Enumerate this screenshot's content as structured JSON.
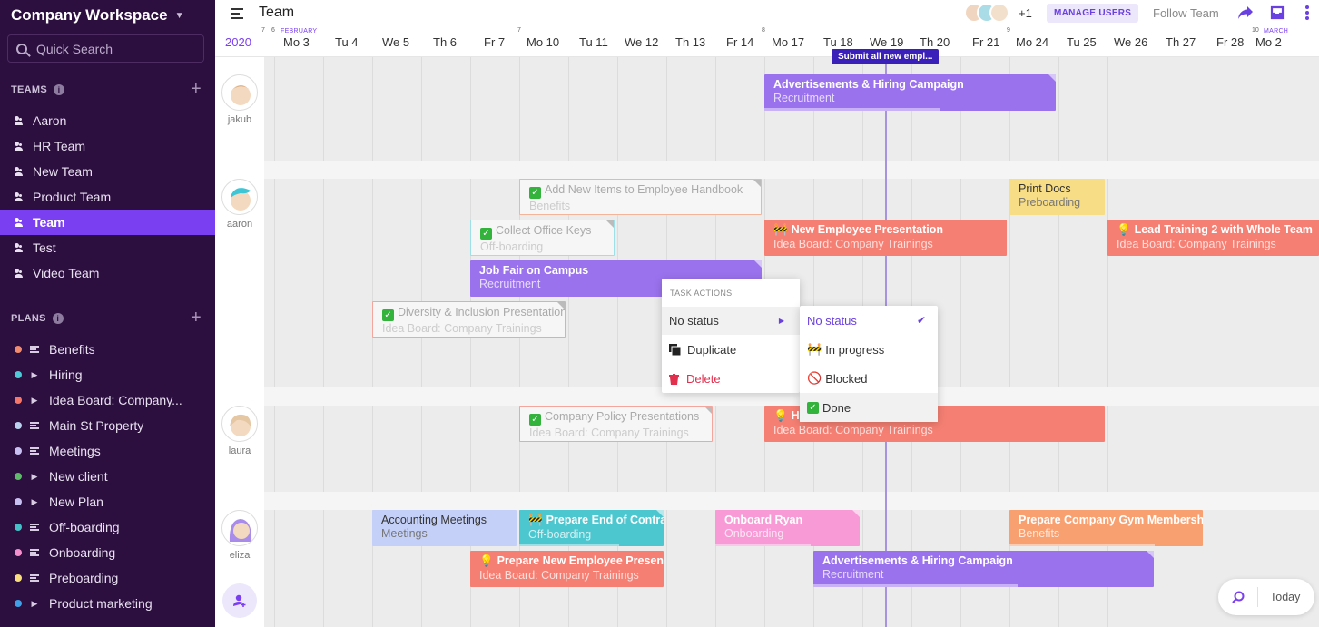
{
  "sidebar": {
    "workspace": "Company Workspace",
    "search_placeholder": "Quick Search",
    "teams_heading": "TEAMS",
    "teams": [
      "Aaron",
      "HR Team",
      "New Team",
      "Product Team",
      "Team",
      "Test",
      "Video Team"
    ],
    "plans_heading": "PLANS",
    "plans": [
      {
        "label": "Benefits",
        "color": "#f28b6e",
        "expandable": false
      },
      {
        "label": "Hiring",
        "color": "#4fc9d8",
        "expandable": true
      },
      {
        "label": "Idea Board: Company...",
        "color": "#f4776a",
        "expandable": true
      },
      {
        "label": "Main St Property",
        "color": "#b9d2f0",
        "expandable": false
      },
      {
        "label": "Meetings",
        "color": "#c8c0f2",
        "expandable": false
      },
      {
        "label": "New client",
        "color": "#5eb96a",
        "expandable": true
      },
      {
        "label": "New Plan",
        "color": "#c8c0f2",
        "expandable": true
      },
      {
        "label": "Off-boarding",
        "color": "#45c0c8",
        "expandable": false
      },
      {
        "label": "Onboarding",
        "color": "#f48fce",
        "expandable": false
      },
      {
        "label": "Preboarding",
        "color": "#f7dd7e",
        "expandable": false
      },
      {
        "label": "Product marketing",
        "color": "#3ea0e8",
        "expandable": true
      }
    ]
  },
  "topbar": {
    "title": "Team",
    "extra_users": "+1",
    "manage_users": "MANAGE USERS",
    "follow": "Follow Team"
  },
  "timeline": {
    "year": "2020",
    "month_feb": "FEBRUARY",
    "month_mar": "MARCH",
    "small_nums": [
      "7",
      "6",
      "7",
      "8",
      "9",
      "10"
    ],
    "days": [
      "Mo 3",
      "Tu 4",
      "We 5",
      "Th 6",
      "Fr 7",
      "Mo 10",
      "Tu 11",
      "We 12",
      "Th 13",
      "Fr 14",
      "Mo 17",
      "Tu 18",
      "We 19",
      "Th 20",
      "Fr 21",
      "Mo 24",
      "Tu 25",
      "We 26",
      "Th 27",
      "Fr 28",
      "Mo 2"
    ]
  },
  "milestone": "Submit all new empl...",
  "people": [
    "jakub",
    "aaron",
    "laura",
    "eliza"
  ],
  "tasks": [
    {
      "title": "Advertisements & Hiring Campaign",
      "plan": "Recruitment"
    },
    {
      "title": "Add New Items to Employee Handbook",
      "plan": "Benefits"
    },
    {
      "title": "Print Docs",
      "plan": "Preboarding"
    },
    {
      "title": "Collect Office Keys",
      "plan": "Off-boarding"
    },
    {
      "title": "New Employee Presentation",
      "plan": "Idea Board: Company Trainings"
    },
    {
      "title": "Lead Training 2 with Whole Team",
      "plan": "Idea Board: Company Trainings"
    },
    {
      "title": "Job Fair on Campus",
      "plan": "Recruitment"
    },
    {
      "title": "Diversity & Inclusion Presentation",
      "plan": "Idea Board: Company Trainings"
    },
    {
      "title": "Company Policy Presentations",
      "plan": "Idea Board: Company Trainings"
    },
    {
      "title": "Ho",
      "plan": "Idea Board: Company Trainings"
    },
    {
      "title": "Accounting Meetings",
      "plan": "Meetings"
    },
    {
      "title": "Prepare End of Contra",
      "plan": "Off-boarding"
    },
    {
      "title": "Onboard Ryan",
      "plan": "Onboarding"
    },
    {
      "title": "Prepare Company Gym Membershi",
      "plan": "Benefits"
    },
    {
      "title": "Prepare New Employee Presenta",
      "plan": "Idea Board: Company Trainings"
    },
    {
      "title": "Advertisements & Hiring Campaign",
      "plan": "Recruitment"
    }
  ],
  "menu": {
    "heading": "TASK ACTIONS",
    "status": "No status",
    "duplicate": "Duplicate",
    "delete": "Delete"
  },
  "submenu": {
    "no_status": "No status",
    "in_progress": "In progress",
    "blocked": "Blocked",
    "done": "Done"
  },
  "bottom": {
    "today": "Today"
  }
}
